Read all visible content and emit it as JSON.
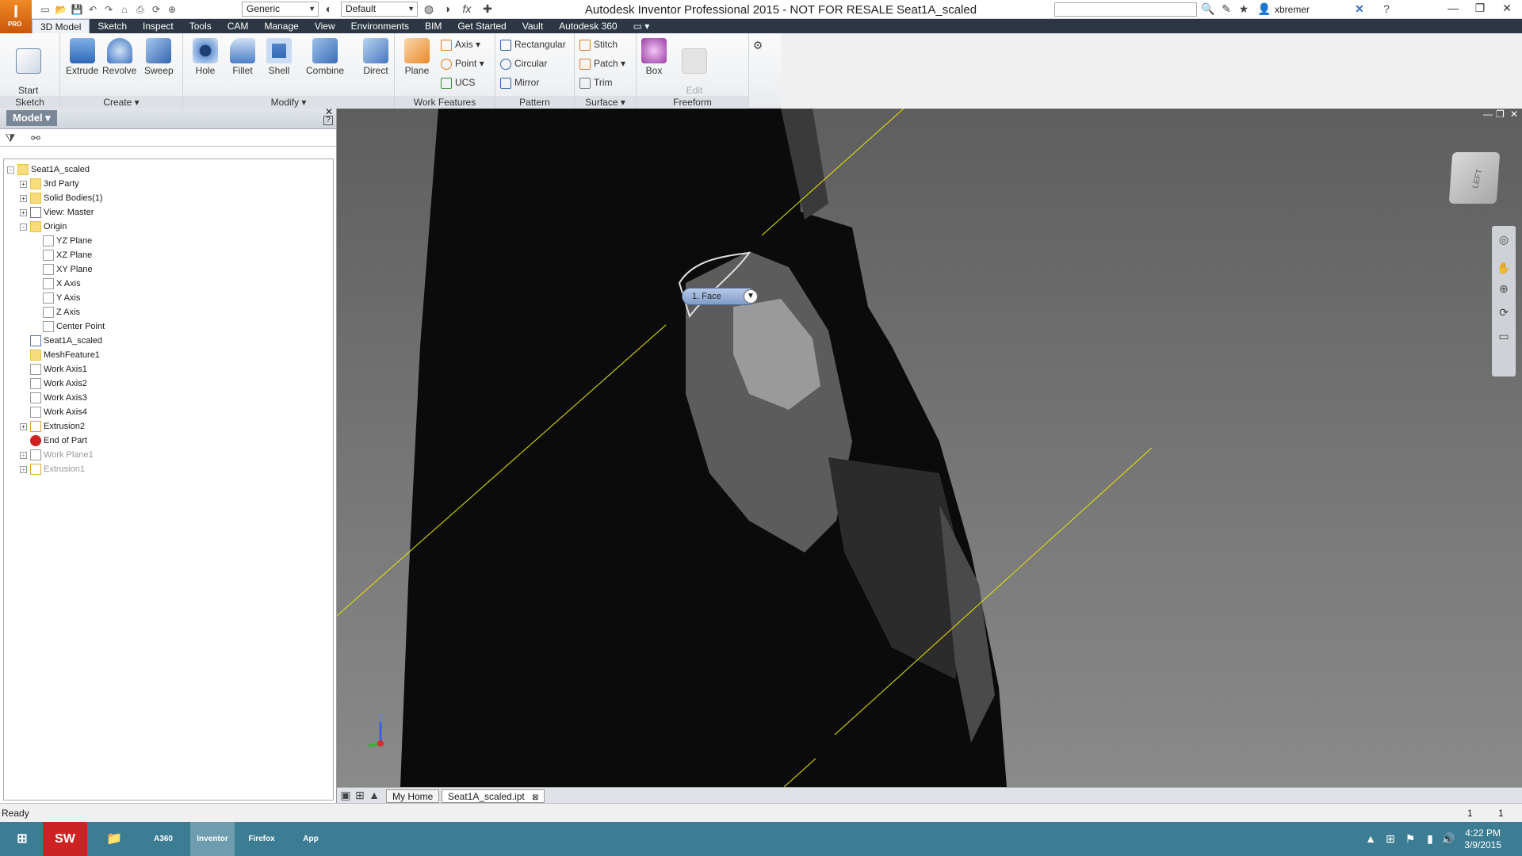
{
  "window": {
    "title": "Autodesk Inventor Professional 2015 - NOT FOR RESALE    Seat1A_scaled",
    "app_icon_letter": "I",
    "app_icon_badge": "PRO"
  },
  "quick_access": {
    "material_combo": "Generic",
    "appearance_combo": "Default",
    "fx_label": "fx",
    "user": "xbremer"
  },
  "menu_tabs": [
    "3D Model",
    "Sketch",
    "Inspect",
    "Tools",
    "CAM",
    "Manage",
    "View",
    "Environments",
    "BIM",
    "Get Started",
    "Vault",
    "Autodesk 360"
  ],
  "ribbon": {
    "sketch": {
      "label": "Sketch",
      "start_sketch": "Start\n2D Sketch"
    },
    "create": {
      "label": "Create ▾",
      "extrude": "Extrude",
      "revolve": "Revolve",
      "sweep": "Sweep"
    },
    "modify": {
      "label": "Modify ▾",
      "hole": "Hole",
      "fillet": "Fillet",
      "shell": "Shell",
      "combine": "Combine",
      "direct": "Direct"
    },
    "work_features": {
      "label": "Work Features",
      "plane": "Plane",
      "axis": "Axis",
      "point": "Point",
      "ucs": "UCS"
    },
    "pattern": {
      "label": "Pattern",
      "rectangular": "Rectangular",
      "circular": "Circular",
      "mirror": "Mirror"
    },
    "surface": {
      "label": "Surface ▾",
      "stitch": "Stitch",
      "patch": "Patch",
      "trim": "Trim"
    },
    "freeform": {
      "label": "Freeform",
      "box": "Box",
      "edit_form": "Edit\nForm"
    }
  },
  "browser": {
    "title": "Model ▾",
    "tree": [
      {
        "label": "Seat1A_scaled",
        "level": 0,
        "expander": "-",
        "icon": "part"
      },
      {
        "label": "3rd Party",
        "level": 1,
        "expander": "+",
        "icon": "folder"
      },
      {
        "label": "Solid Bodies(1)",
        "level": 1,
        "expander": "+",
        "icon": "folder"
      },
      {
        "label": "View: Master",
        "level": 1,
        "expander": "+",
        "icon": "view"
      },
      {
        "label": "Origin",
        "level": 1,
        "expander": "-",
        "icon": "folder-open"
      },
      {
        "label": "YZ Plane",
        "level": 2,
        "expander": "",
        "icon": "plane"
      },
      {
        "label": "XZ Plane",
        "level": 2,
        "expander": "",
        "icon": "plane"
      },
      {
        "label": "XY Plane",
        "level": 2,
        "expander": "",
        "icon": "plane"
      },
      {
        "label": "X Axis",
        "level": 2,
        "expander": "",
        "icon": "axis"
      },
      {
        "label": "Y Axis",
        "level": 2,
        "expander": "",
        "icon": "axis"
      },
      {
        "label": "Z Axis",
        "level": 2,
        "expander": "",
        "icon": "axis"
      },
      {
        "label": "Center Point",
        "level": 2,
        "expander": "",
        "icon": "point"
      },
      {
        "label": "Seat1A_scaled",
        "level": 1,
        "expander": "",
        "icon": "mesh"
      },
      {
        "label": "MeshFeature1",
        "level": 1,
        "expander": "",
        "icon": "part"
      },
      {
        "label": "Work Axis1",
        "level": 1,
        "expander": "",
        "icon": "axis"
      },
      {
        "label": "Work Axis2",
        "level": 1,
        "expander": "",
        "icon": "axis"
      },
      {
        "label": "Work Axis3",
        "level": 1,
        "expander": "",
        "icon": "axis"
      },
      {
        "label": "Work Axis4",
        "level": 1,
        "expander": "",
        "icon": "axis"
      },
      {
        "label": "Extrusion2",
        "level": 1,
        "expander": "+",
        "icon": "extrude"
      },
      {
        "label": "End of Part",
        "level": 1,
        "expander": "",
        "icon": "eop"
      },
      {
        "label": "Work Plane1",
        "level": 1,
        "expander": "+",
        "icon": "plane",
        "dim": true
      },
      {
        "label": "Extrusion1",
        "level": 1,
        "expander": "+",
        "icon": "extrude",
        "dim": true
      }
    ]
  },
  "viewport": {
    "selection_label": "1. Face",
    "viewcube_face": "LEFT"
  },
  "doc_tabs": [
    "My Home",
    "Seat1A_scaled.ipt"
  ],
  "status": {
    "text": "Ready",
    "count1": "1",
    "count2": "1"
  },
  "taskbar": {
    "apps": [
      "SW",
      "A360",
      "Inventor",
      "Firefox",
      "App"
    ],
    "time": "4:22 PM",
    "date": "3/9/2015"
  },
  "colors": {
    "menubar": "#2d3744",
    "taskbar": "#3d7d94",
    "accent": "#f08a24",
    "work_axis": "#e8e800"
  }
}
